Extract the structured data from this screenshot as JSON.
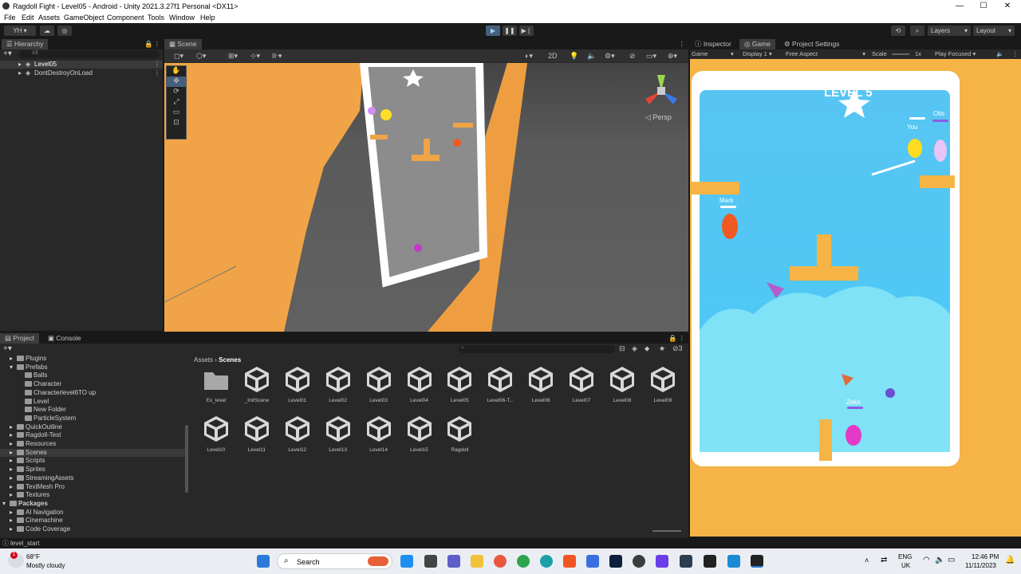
{
  "window": {
    "title": "Ragdoll Fight - Level05 - Android - Unity 2021.3.27f1 Personal <DX11>",
    "minimize": "—",
    "maximize": "☐",
    "close": "✕"
  },
  "menu": [
    "File",
    "Edit",
    "Assets",
    "GameObject",
    "Component",
    "Tools",
    "Window",
    "Help"
  ],
  "toolbar": {
    "account": "YH",
    "layers": "Layers",
    "layout": "Layout"
  },
  "hierarchy": {
    "tab": "Hierarchy",
    "search_placeholder": "All",
    "items": [
      "Level05",
      "DontDestroyOnLoad"
    ]
  },
  "scene": {
    "tab": "Scene",
    "mode_2d": "2D",
    "persp": "◁ Persp"
  },
  "game_tabs": {
    "inspector": "Inspector",
    "game": "Game",
    "project_settings": "Project Settings"
  },
  "game_bar": {
    "game": "Game",
    "display": "Display 1",
    "aspect": "Free Aspect",
    "scale": "Scale",
    "scale_value": "1x",
    "play_focused": "Play Focused"
  },
  "game_view": {
    "level": "LEVEL 5",
    "players": {
      "you": "You",
      "otis": "Otis",
      "mark": "Mark",
      "zeke": "Zeke"
    }
  },
  "project": {
    "tab_project": "Project",
    "tab_console": "Console",
    "count": "3",
    "tree": [
      {
        "label": "Plugins",
        "indent": 1
      },
      {
        "label": "Prefabs",
        "indent": 1
      },
      {
        "label": "Balls",
        "indent": 2
      },
      {
        "label": "Character",
        "indent": 2
      },
      {
        "label": "Characterlevel6TO up",
        "indent": 2
      },
      {
        "label": "Level",
        "indent": 2
      },
      {
        "label": "New Folder",
        "indent": 2
      },
      {
        "label": "ParticleSystem",
        "indent": 2
      },
      {
        "label": "QuickOutline",
        "indent": 1
      },
      {
        "label": "Ragdoll-Test",
        "indent": 1
      },
      {
        "label": "Resources",
        "indent": 1
      },
      {
        "label": "Scenes",
        "indent": 1
      },
      {
        "label": "Scripts",
        "indent": 1
      },
      {
        "label": "Sprites",
        "indent": 1
      },
      {
        "label": "StreamingAssets",
        "indent": 1
      },
      {
        "label": "TextMesh Pro",
        "indent": 1
      },
      {
        "label": "Textures",
        "indent": 1
      },
      {
        "label": "Packages",
        "indent": 0
      },
      {
        "label": "AI Navigation",
        "indent": 1
      },
      {
        "label": "Cinemachine",
        "indent": 1
      },
      {
        "label": "Code Coverage",
        "indent": 1
      }
    ],
    "breadcrumb": {
      "root": "Assets",
      "sep": "›",
      "current": "Scenes"
    },
    "assets": [
      "Ex_level",
      "_InitScene",
      "Level01",
      "Level02",
      "Level03",
      "Level04",
      "Level05",
      "Level06-T...",
      "Level06",
      "Level07",
      "Level08",
      "Level09",
      "Level10",
      "Level11",
      "Level12",
      "Level13",
      "Level14",
      "Level15",
      "Ragdoll"
    ]
  },
  "status": {
    "text": "level_start"
  },
  "taskbar": {
    "weather_temp": "68°F",
    "weather_desc": "Mostly cloudy",
    "search": "Search",
    "lang1": "ENG",
    "lang2": "UK",
    "time": "12:46 PM",
    "date": "11/11/2023",
    "notif": "1"
  }
}
